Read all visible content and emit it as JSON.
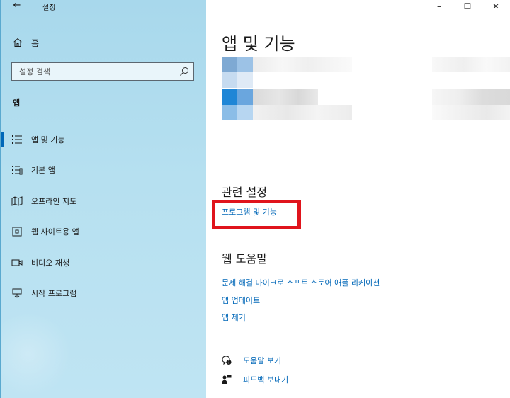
{
  "window": {
    "title": "설정",
    "back_icon": "←",
    "minimize_icon": "–",
    "maximize_icon": "☐",
    "close_icon": "✕"
  },
  "sidebar": {
    "home_label": "홈",
    "search_placeholder": "설정 검색",
    "section_label": "앱",
    "items": [
      {
        "label": "앱 및 기능",
        "icon": "apps-features-icon",
        "selected": true
      },
      {
        "label": "기본 앱",
        "icon": "default-apps-icon",
        "selected": false
      },
      {
        "label": "오프라인 지도",
        "icon": "offline-maps-icon",
        "selected": false
      },
      {
        "label": "웹 사이트용 앱",
        "icon": "apps-for-websites-icon",
        "selected": false
      },
      {
        "label": "비디오 재생",
        "icon": "video-playback-icon",
        "selected": false
      },
      {
        "label": "시작 프로그램",
        "icon": "startup-icon",
        "selected": false
      }
    ]
  },
  "main": {
    "title": "앱 및 기능",
    "related_settings": {
      "heading": "관련 설정",
      "link": "프로그램 및 기능"
    },
    "web_help": {
      "heading": "웹 도움말",
      "links": [
        "문제 해결 마이크로 소프트 스토어 애플 리케이션",
        "앱 업데이트",
        "앱 제거"
      ]
    },
    "footer": [
      {
        "label": "도움말 보기",
        "icon": "get-help-icon"
      },
      {
        "label": "피드백 보내기",
        "icon": "give-feedback-icon"
      }
    ]
  },
  "colors": {
    "accent": "#0067b8",
    "highlight_box": "#e0141c",
    "sidebar_bg": "#b6e0f0"
  }
}
